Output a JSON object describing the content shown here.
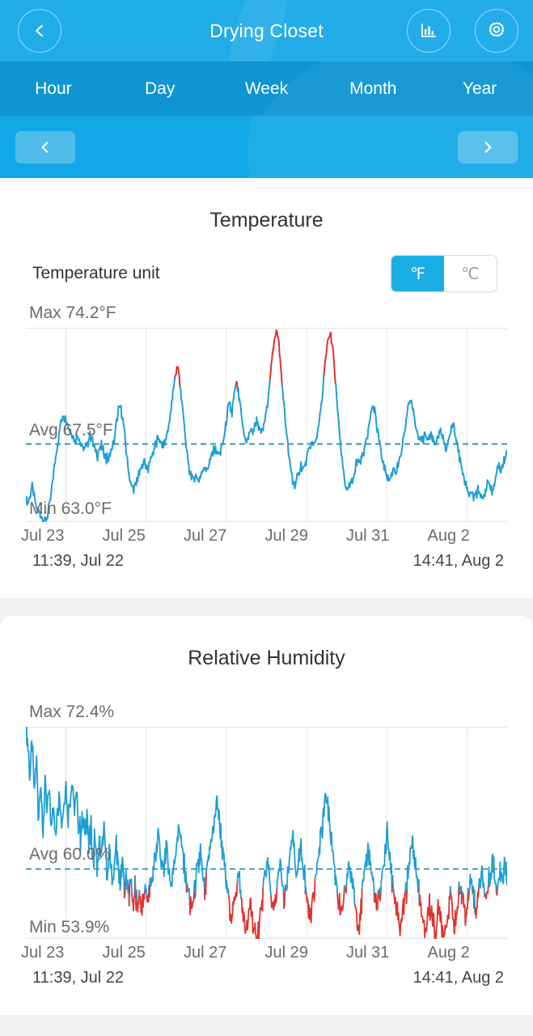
{
  "header": {
    "title": "Drying Closet",
    "back_icon": "chevron-left-icon",
    "stats_icon": "bar-chart-icon",
    "settings_icon": "gear-icon"
  },
  "tabs": [
    {
      "label": "Hour",
      "active": false
    },
    {
      "label": "Day",
      "active": false
    },
    {
      "label": "Week",
      "active": false
    },
    {
      "label": "Month",
      "active": false
    },
    {
      "label": "Year",
      "active": false
    }
  ],
  "pager": {
    "prev_icon": "chevron-left-icon",
    "next_icon": "chevron-right-icon"
  },
  "temperature": {
    "title": "Temperature",
    "unit_label": "Temperature unit",
    "unit_options": [
      "℉",
      "℃"
    ],
    "unit_selected": "℉",
    "max_label": "Max 74.2°F",
    "avg_label": "Avg 67.5°F",
    "min_label": "Min 63.0°F",
    "range_start": "11:39, Jul 22",
    "range_end": "14:41, Aug 2"
  },
  "humidity": {
    "title": "Relative Humidity",
    "max_label": "Max 72.4%",
    "avg_label": "Avg 60.0%",
    "min_label": "Min 53.9%",
    "range_start": "11:39, Jul 22",
    "range_end": "14:41, Aug 2"
  },
  "colors": {
    "header_blue": "#12a7e6",
    "tab_blue": "#0e95d2",
    "line_blue": "#1f9ed4",
    "line_red": "#e0332f",
    "accent": "#19ade4",
    "grid": "#e4e4e4",
    "text_muted": "#6b6b6b"
  },
  "chart_data": [
    {
      "type": "line",
      "title": "Temperature",
      "xlabel": "",
      "ylabel": "°F",
      "ylim": [
        63.0,
        74.2
      ],
      "grid": true,
      "legend": "none",
      "tick_labels": [
        "Jul 23",
        "Jul 25",
        "Jul 27",
        "Jul 29",
        "Jul 31",
        "Aug 2"
      ],
      "annotations": {
        "max": 74.2,
        "avg": 67.5,
        "min": 63.0,
        "avg_line": 67.5,
        "threshold_red_above": 71.0,
        "range_start": "11:39, Jul 22",
        "range_end": "14:41, Aug 2"
      },
      "series": [
        {
          "name": "Temperature (°F)",
          "color_normal": "#1f9ed4",
          "color_alert": "#e0332f",
          "values": [
            64.3,
            64.1,
            64.6,
            65.0,
            64.4,
            63.8,
            63.6,
            63.4,
            63.2,
            63.0,
            63.3,
            63.7,
            64.6,
            65.6,
            66.5,
            67.4,
            68.2,
            68.9,
            69.2,
            69.0,
            68.6,
            68.3,
            68.1,
            67.7,
            67.9,
            68.0,
            67.6,
            67.3,
            67.2,
            67.4,
            67.8,
            68.0,
            67.6,
            67.1,
            66.9,
            67.2,
            67.4,
            67.0,
            66.7,
            66.5,
            66.9,
            67.2,
            67.6,
            68.6,
            69.4,
            69.6,
            69.0,
            68.0,
            66.8,
            65.8,
            65.2,
            64.9,
            65.1,
            65.4,
            65.8,
            66.1,
            66.5,
            66.3,
            66.0,
            66.4,
            66.9,
            67.2,
            67.5,
            67.9,
            67.6,
            67.3,
            67.5,
            68.0,
            68.6,
            69.4,
            70.4,
            71.4,
            72.0,
            71.4,
            70.2,
            69.0,
            67.8,
            66.6,
            65.9,
            65.6,
            65.5,
            65.7,
            65.4,
            65.6,
            66.0,
            66.2,
            66.0,
            66.3,
            66.7,
            67.0,
            67.3,
            67.0,
            66.8,
            67.2,
            67.6,
            68.4,
            69.3,
            69.8,
            69.2,
            70.2,
            71.1,
            70.6,
            69.6,
            68.6,
            67.8,
            67.6,
            68.0,
            68.4,
            68.2,
            68.6,
            68.9,
            68.4,
            68.1,
            68.5,
            69.0,
            69.9,
            71.0,
            72.2,
            73.3,
            74.2,
            73.6,
            72.3,
            70.8,
            69.4,
            68.2,
            67.0,
            66.0,
            65.4,
            65.2,
            65.5,
            65.9,
            66.3,
            66.0,
            66.4,
            66.8,
            67.2,
            67.6,
            67.4,
            67.8,
            68.3,
            69.1,
            70.2,
            71.6,
            72.8,
            73.6,
            73.9,
            73.1,
            71.6,
            70.0,
            68.4,
            67.0,
            66.0,
            65.2,
            64.8,
            65.0,
            65.3,
            65.7,
            66.2,
            66.6,
            66.4,
            66.8,
            67.2,
            67.8,
            68.4,
            69.2,
            69.8,
            69.4,
            68.6,
            67.8,
            67.0,
            66.4,
            66.0,
            65.6,
            65.4,
            65.8,
            66.1,
            65.9,
            66.2,
            66.6,
            67.2,
            68.0,
            68.9,
            69.8,
            70.2,
            69.6,
            68.8,
            68.2,
            67.9,
            68.1,
            67.8,
            68.0,
            67.6,
            67.9,
            68.1,
            67.7,
            67.4,
            67.8,
            68.2,
            67.9,
            67.5,
            67.2,
            67.6,
            68.2,
            68.6,
            68.2,
            67.6,
            67.0,
            66.4,
            65.8,
            65.2,
            64.8,
            64.5,
            64.7,
            64.4,
            64.6,
            64.9,
            64.6,
            64.3,
            64.5,
            65.0,
            65.4,
            65.0,
            64.7,
            65.2,
            65.8,
            66.4,
            66.0,
            66.3,
            66.8,
            67.0
          ]
        }
      ]
    },
    {
      "type": "line",
      "title": "Relative Humidity",
      "xlabel": "",
      "ylabel": "%",
      "ylim": [
        53.9,
        72.4
      ],
      "grid": true,
      "legend": "none",
      "tick_labels": [
        "Jul 23",
        "Jul 25",
        "Jul 27",
        "Jul 29",
        "Jul 31",
        "Aug 2"
      ],
      "annotations": {
        "max": 72.4,
        "avg": 60.0,
        "min": 53.9,
        "avg_line": 60.0,
        "threshold_red_below": 58.0,
        "range_start": "11:39, Jul 22",
        "range_end": "14:41, Aug 2"
      },
      "series": [
        {
          "name": "Relative Humidity (%)",
          "color_normal": "#1f9ed4",
          "color_alert": "#e0332f",
          "values": [
            72.4,
            70.8,
            68.2,
            71.0,
            66.4,
            69.8,
            64.2,
            68.0,
            62.6,
            67.2,
            64.8,
            66.9,
            63.4,
            66.0,
            62.2,
            65.4,
            66.8,
            64.0,
            65.8,
            67.4,
            64.6,
            66.2,
            68.0,
            65.0,
            66.4,
            64.2,
            62.8,
            64.6,
            63.0,
            65.2,
            61.8,
            63.6,
            60.4,
            62.8,
            59.6,
            62.0,
            60.8,
            63.4,
            61.0,
            59.2,
            61.6,
            58.8,
            60.2,
            62.4,
            59.8,
            58.4,
            60.6,
            58.0,
            59.4,
            57.6,
            58.8,
            57.0,
            58.2,
            56.4,
            57.8,
            56.0,
            57.4,
            58.6,
            57.2,
            58.0,
            59.2,
            60.4,
            61.8,
            63.2,
            61.4,
            59.8,
            60.8,
            62.2,
            60.0,
            58.6,
            59.8,
            61.2,
            62.6,
            64.0,
            62.2,
            60.6,
            59.4,
            58.2,
            57.0,
            56.2,
            57.4,
            58.6,
            60.0,
            61.4,
            59.6,
            58.0,
            59.2,
            60.6,
            62.0,
            63.4,
            64.8,
            66.2,
            64.4,
            62.6,
            61.0,
            59.4,
            58.0,
            56.6,
            55.4,
            56.8,
            58.2,
            59.6,
            58.0,
            56.4,
            55.0,
            54.6,
            55.8,
            57.2,
            55.6,
            54.2,
            53.9,
            55.2,
            56.6,
            58.0,
            59.4,
            60.8,
            59.0,
            57.4,
            56.0,
            57.6,
            59.0,
            60.4,
            58.8,
            57.2,
            58.6,
            60.0,
            61.4,
            62.8,
            61.0,
            59.2,
            60.6,
            62.0,
            60.2,
            58.4,
            57.0,
            55.8,
            56.8,
            58.2,
            59.6,
            61.0,
            62.4,
            63.8,
            65.2,
            66.6,
            65.0,
            63.2,
            61.6,
            60.0,
            58.4,
            57.0,
            55.8,
            56.8,
            58.0,
            59.4,
            60.8,
            59.2,
            57.8,
            56.4,
            55.2,
            56.4,
            57.8,
            59.2,
            60.6,
            62.0,
            60.4,
            58.8,
            57.4,
            56.0,
            57.2,
            58.6,
            60.0,
            61.4,
            62.8,
            61.2,
            59.6,
            58.2,
            56.8,
            55.6,
            54.4,
            55.6,
            57.0,
            58.4,
            59.8,
            61.2,
            62.6,
            61.0,
            59.4,
            58.0,
            56.6,
            55.2,
            54.6,
            55.8,
            57.0,
            56.2,
            55.0,
            54.4,
            55.6,
            56.8,
            55.4,
            54.2,
            55.4,
            56.6,
            57.8,
            56.4,
            55.0,
            56.2,
            57.4,
            58.6,
            57.2,
            55.8,
            56.8,
            58.0,
            59.2,
            57.8,
            56.4,
            57.6,
            58.8,
            60.0,
            58.6,
            57.2,
            58.4,
            59.6,
            60.8,
            59.4,
            58.0,
            59.2,
            60.4,
            59.0,
            60.2,
            59.6
          ]
        }
      ]
    }
  ]
}
